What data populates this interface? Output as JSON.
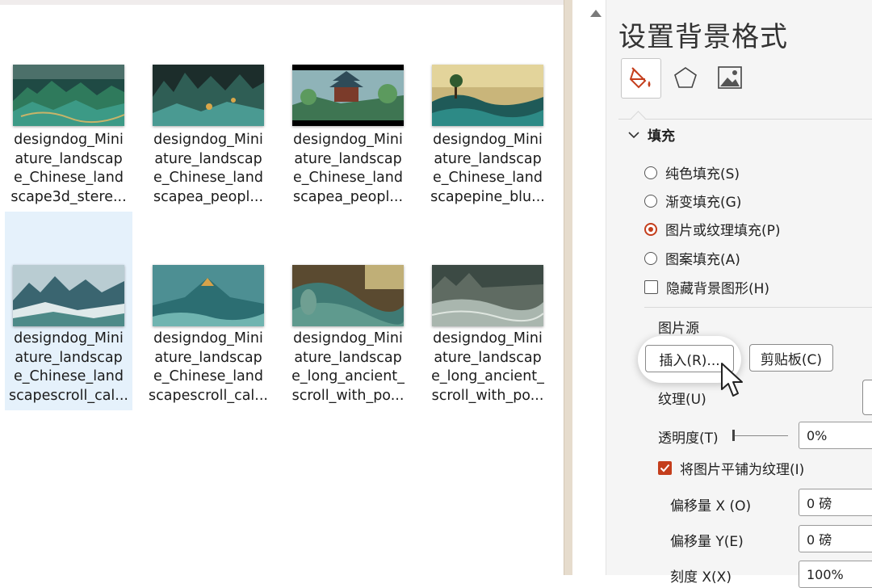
{
  "file_browser": {
    "files": [
      {
        "name": "designdog_Miniature_landscape_Chinese_landscape3d_stere...",
        "lines": [
          "designdog_Mini",
          "ature_landscap",
          "e_Chinese_land",
          "scape3d_stere..."
        ],
        "selected": false
      },
      {
        "name": "designdog_Miniature_landscape_Chinese_landscapea_peopl...",
        "lines": [
          "designdog_Mini",
          "ature_landscap",
          "e_Chinese_land",
          "scapea_peopl..."
        ],
        "selected": false
      },
      {
        "name": "designdog_Miniature_landscape_Chinese_landscapea_peopl...",
        "lines": [
          "designdog_Mini",
          "ature_landscap",
          "e_Chinese_land",
          "scapea_peopl..."
        ],
        "selected": false
      },
      {
        "name": "designdog_Miniature_landscape_Chinese_landscapepine_blu...",
        "lines": [
          "designdog_Mini",
          "ature_landscap",
          "e_Chinese_land",
          "scapepine_blu..."
        ],
        "selected": false
      },
      {
        "name": "designdog_Miniature_landscape_Chinese_landscapescroll_cal...",
        "lines": [
          "designdog_Mini",
          "ature_landscap",
          "e_Chinese_land",
          "scapescroll_cal..."
        ],
        "selected": true
      },
      {
        "name": "designdog_Miniature_landscape_Chinese_landscapescroll_cal...",
        "lines": [
          "designdog_Mini",
          "ature_landscap",
          "e_Chinese_land",
          "scapescroll_cal..."
        ],
        "selected": false
      },
      {
        "name": "designdog_Miniature_landscape_long_ancient_scroll_with_po...",
        "lines": [
          "designdog_Mini",
          "ature_landscap",
          "e_long_ancient_",
          "scroll_with_po..."
        ],
        "selected": false
      },
      {
        "name": "designdog_Miniature_landscape_long_ancient_scroll_with_po...",
        "lines": [
          "designdog_Mini",
          "ature_landscap",
          "e_long_ancient_",
          "scroll_with_po..."
        ],
        "selected": false
      }
    ]
  },
  "format_pane": {
    "title": "设置背景格式",
    "tabs": [
      {
        "icon": "fill-bucket-icon",
        "active": true
      },
      {
        "icon": "pentagon-effects-icon",
        "active": false
      },
      {
        "icon": "picture-icon",
        "active": false
      }
    ],
    "fill_section": {
      "label": "填充",
      "expanded": true,
      "options": [
        {
          "label": "纯色填充(S)",
          "checked": false
        },
        {
          "label": "渐变填充(G)",
          "checked": false
        },
        {
          "label": "图片或纹理填充(P)",
          "checked": true
        },
        {
          "label": "图案填充(A)",
          "checked": false
        }
      ],
      "hide_graphics": {
        "label": "隐藏背景图形(H)",
        "checked": false
      }
    },
    "picture_source": {
      "label": "图片源",
      "insert_button": "插入(R)...",
      "clipboard_button": "剪贴板(C)"
    },
    "texture": {
      "label": "纹理(U)"
    },
    "transparency": {
      "label": "透明度(T)",
      "value": "0%",
      "level": 0
    },
    "tile_as_texture": {
      "label": "将图片平铺为纹理(I)",
      "checked": true
    },
    "offset_x": {
      "label": "偏移量 X (O)",
      "value": "0 磅"
    },
    "offset_y": {
      "label": "偏移量 Y(E)",
      "value": "0 磅"
    },
    "scale_x": {
      "label": "刻度 X(X)",
      "value": "100%"
    }
  },
  "colors": {
    "accent": "#c43e1c",
    "selection": "#e5f1fb",
    "pane_bg": "#f5f5f5"
  }
}
